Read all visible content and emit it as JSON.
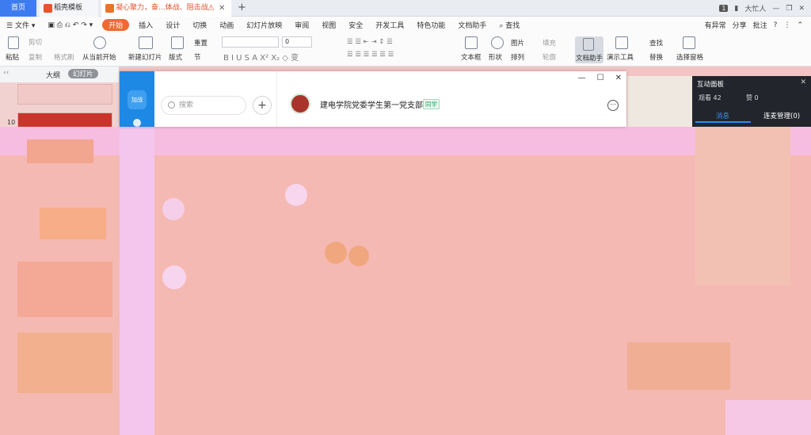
{
  "tabs": {
    "home": "首页",
    "templates": "稻壳模板",
    "document": "凝心聚力，奋...体战、阻击战"
  },
  "window": {
    "user": "大忙人",
    "page_indicator": "1"
  },
  "menu": {
    "file": "文件",
    "items": [
      "开始",
      "插入",
      "设计",
      "切换",
      "动画",
      "幻灯片放映",
      "审阅",
      "视图",
      "安全",
      "开发工具",
      "特色功能",
      "文档助手"
    ],
    "search": "查找",
    "right": [
      "有异常",
      "分享",
      "批注"
    ]
  },
  "ribbon": {
    "paste": "粘贴",
    "cut": "剪切",
    "copy": "复制",
    "format_painter": "格式刷",
    "play_from_current": "从当前开始",
    "new_slide": "新建幻灯片",
    "layout": "版式",
    "section": "节",
    "reset": "重置",
    "font_size": "0",
    "text_box": "文本框",
    "shape": "形状",
    "picture": "图片",
    "fill": "填充",
    "arrange": "排列",
    "outline": "轮廓",
    "doc_assistant": "文档助手",
    "presentation_tools": "演示工具",
    "find": "查找",
    "replace": "替换",
    "select_pane": "选择窗格"
  },
  "left_pane": {
    "outline_tab": "大纲",
    "slides_tab": "幻灯片",
    "slide_number": "10"
  },
  "chat": {
    "rail_logo": "加战",
    "search_placeholder": "搜索",
    "add": "+",
    "group_name": "建电学院党委学生第一党支部",
    "group_tag": "同学",
    "more": "⋯"
  },
  "right_panel": {
    "title": "互动面板",
    "viewers": "观看 42",
    "likes": "赞 0",
    "tab_messages": "消息",
    "tab_mic": "连麦管理(0)"
  }
}
